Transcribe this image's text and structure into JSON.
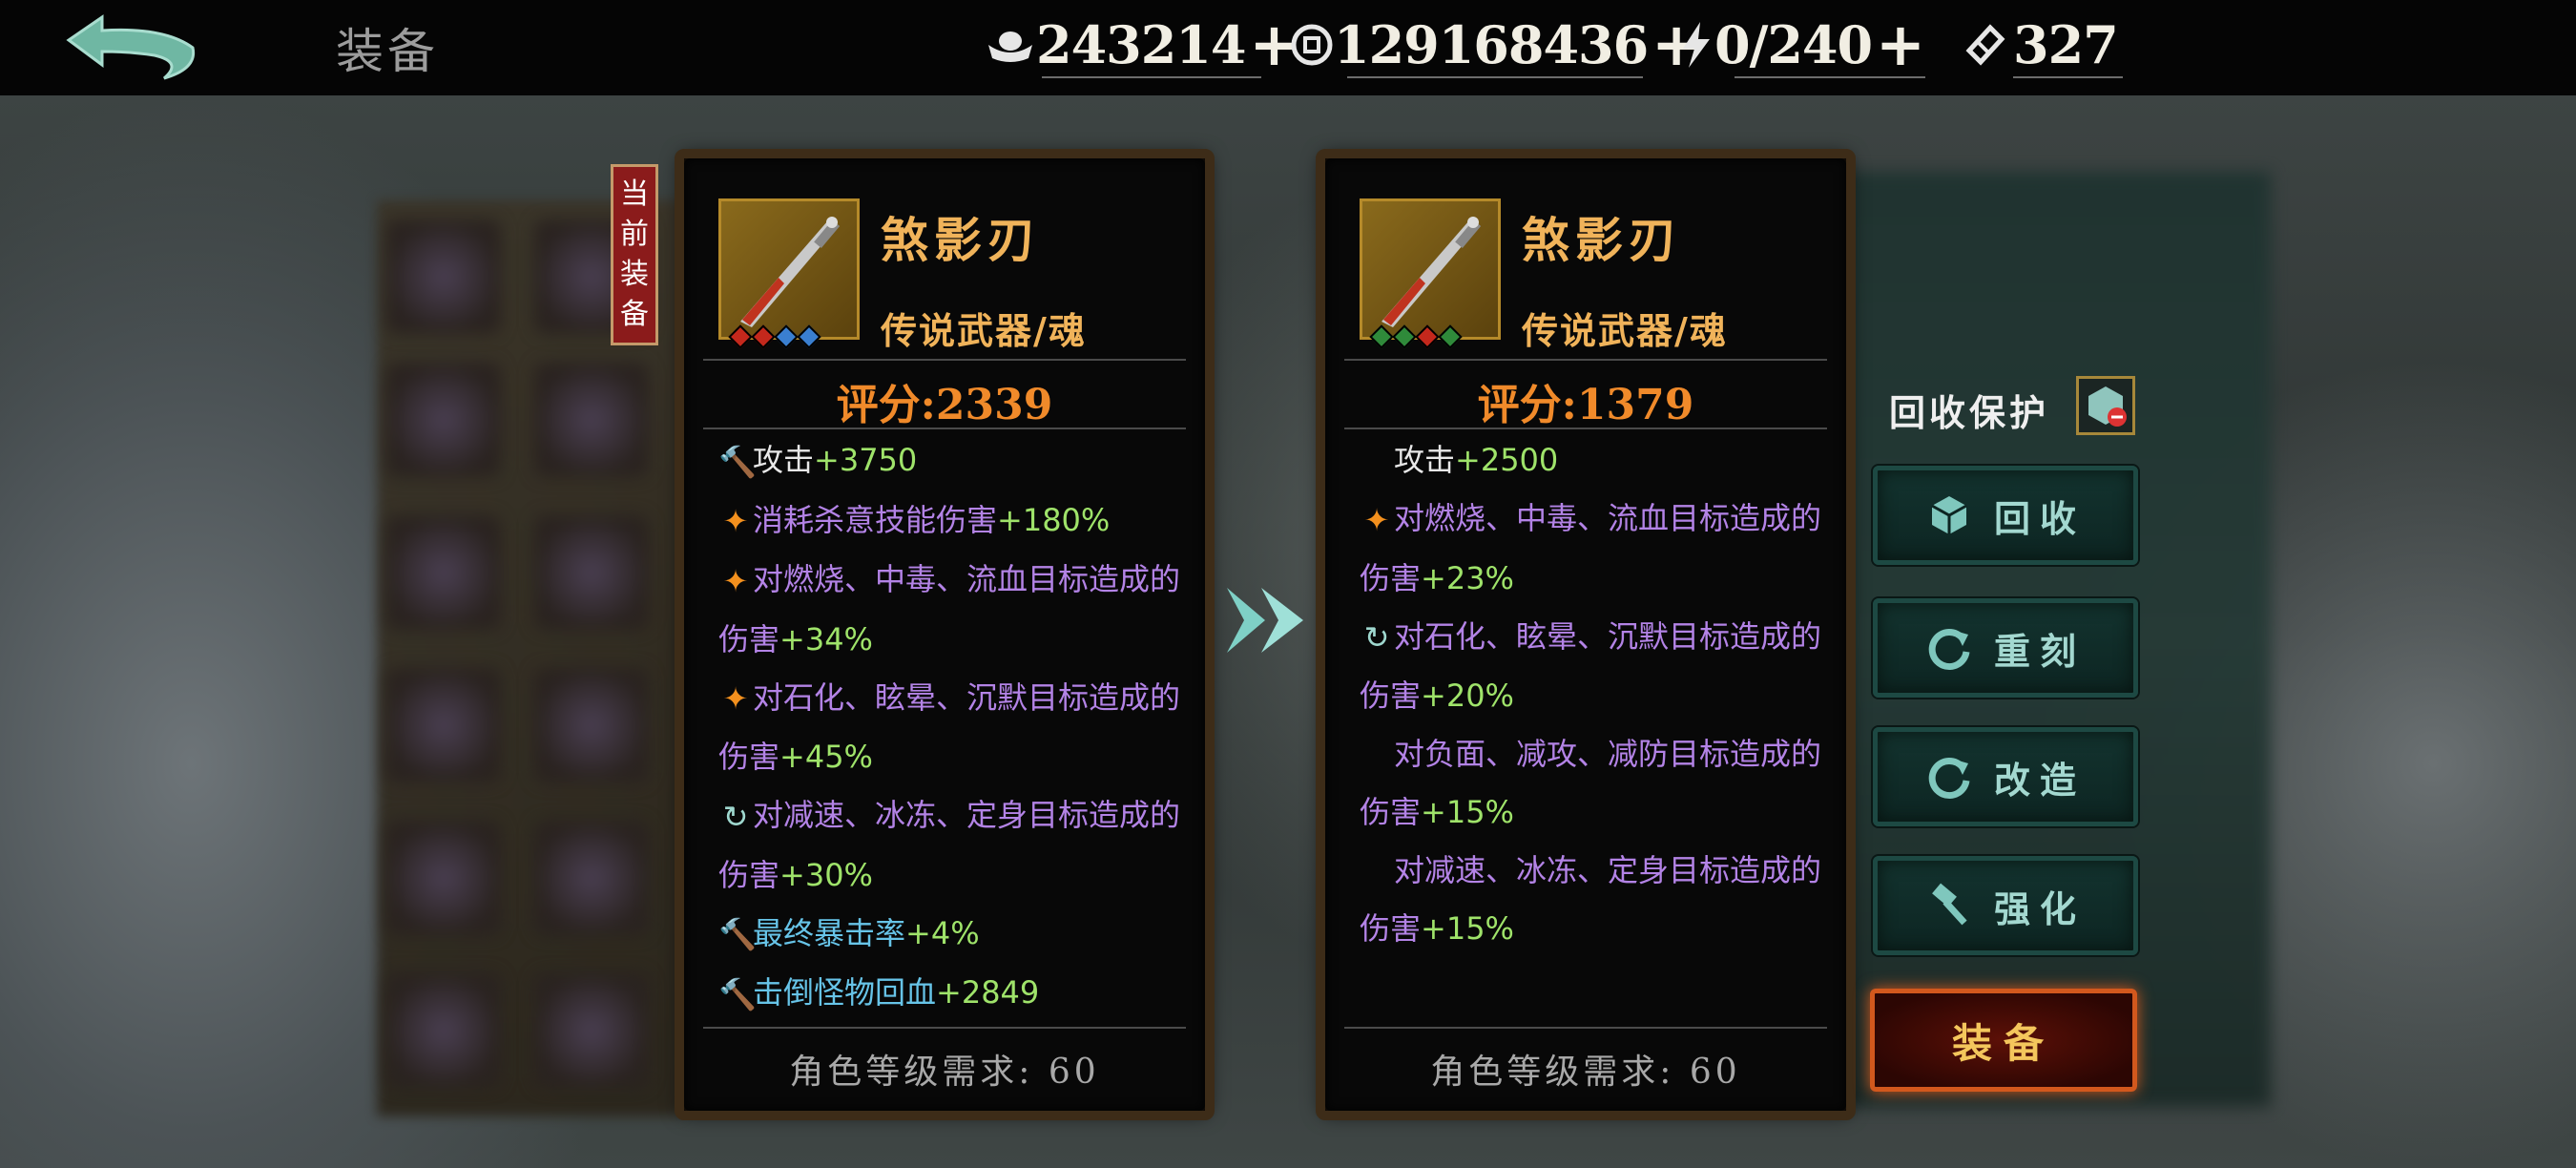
{
  "header": {
    "title": "装备",
    "resources": [
      {
        "icon": "silver-ingot-icon",
        "value": "243214"
      },
      {
        "icon": "coin-icon",
        "value": "129168436"
      },
      {
        "icon": "lightning-icon",
        "value": "0/240"
      },
      {
        "icon": "ticket-icon",
        "value": "327"
      }
    ]
  },
  "current_tag": "当前装备",
  "current_item": {
    "name": "煞影刃",
    "type": "传说武器/魂",
    "score": "评分:2339",
    "gem_colors": [
      "#c4281c",
      "#c4281c",
      "#3a7fd0",
      "#3a7fd0"
    ],
    "stats": [
      {
        "icon": "hammer-icon",
        "text": "攻击",
        "value": "+3750",
        "color": "white"
      },
      {
        "icon": "flame-icon",
        "text": "消耗杀意技能伤害",
        "value": "+180%",
        "color": "purple"
      },
      {
        "icon": "flame-icon",
        "text": "对燃烧、中毒、流血目标造成的",
        "color": "purple"
      },
      {
        "text": "伤害",
        "value": "+34%",
        "color": "purple"
      },
      {
        "icon": "flame-icon",
        "text": "对石化、眩晕、沉默目标造成的",
        "color": "purple"
      },
      {
        "text": "伤害",
        "value": "+45%",
        "color": "purple"
      },
      {
        "icon": "refresh-icon",
        "text": "对减速、冰冻、定身目标造成的",
        "color": "purple"
      },
      {
        "text": "伤害",
        "value": "+30%",
        "color": "purple"
      },
      {
        "icon": "hammer-icon",
        "text": "最终暴击率",
        "value": "+4%",
        "color": "cyan"
      },
      {
        "icon": "hammer-icon",
        "text": "击倒怪物回血",
        "value": "+2849",
        "color": "cyan"
      }
    ],
    "requirement": "角色等级需求: 60"
  },
  "new_item": {
    "name": "煞影刃",
    "type": "传说武器/魂",
    "score": "评分:1379",
    "gem_colors": [
      "#2f8a3a",
      "#2f8a3a",
      "#c4281c",
      "#2f8a3a"
    ],
    "stats": [
      {
        "text": "攻击",
        "value": "+2500",
        "color": "white"
      },
      {
        "icon": "flame-icon",
        "text": "对燃烧、中毒、流血目标造成的",
        "color": "purple"
      },
      {
        "text": "伤害",
        "value": "+23%",
        "color": "purple"
      },
      {
        "icon": "refresh-icon",
        "text": "对石化、眩晕、沉默目标造成的",
        "color": "purple"
      },
      {
        "text": "伤害",
        "value": "+20%",
        "color": "purple"
      },
      {
        "text": "对负面、减攻、减防目标造成的",
        "color": "purple"
      },
      {
        "text": "伤害",
        "value": "+15%",
        "color": "purple"
      },
      {
        "text": "对减速、冰冻、定身目标造成的",
        "color": "purple"
      },
      {
        "text": "伤害",
        "value": "+15%",
        "color": "purple"
      }
    ],
    "requirement": "角色等级需求: 60"
  },
  "actions": {
    "protect_label": "回收保护",
    "recycle": "回收",
    "reforge": "重刻",
    "modify": "改造",
    "strengthen": "强化",
    "equip": "装备"
  }
}
